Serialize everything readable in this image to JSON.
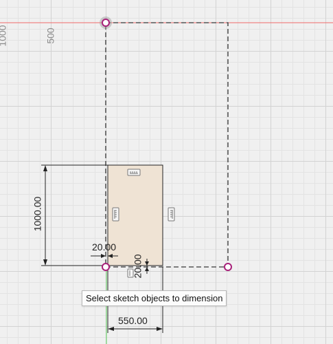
{
  "rulers": {
    "left_tick_1000": "1000",
    "left_tick_500": "500"
  },
  "dimensions": {
    "height": "1000.00",
    "width": "550.00",
    "offset_left": "20.00",
    "offset_bottom": "20.00"
  },
  "tooltip": {
    "text": "Select sketch objects to dimension"
  },
  "colors": {
    "axis_red": "#f06a6a",
    "axis_green": "#5fcf5f",
    "body_fill": "#efe3d4",
    "point_magenta": "#a8217a",
    "dashed_line": "#555555"
  },
  "icons": [
    "horizontal-constraint-icon",
    "vertical-constraint-icon",
    "point-marker-icon"
  ]
}
